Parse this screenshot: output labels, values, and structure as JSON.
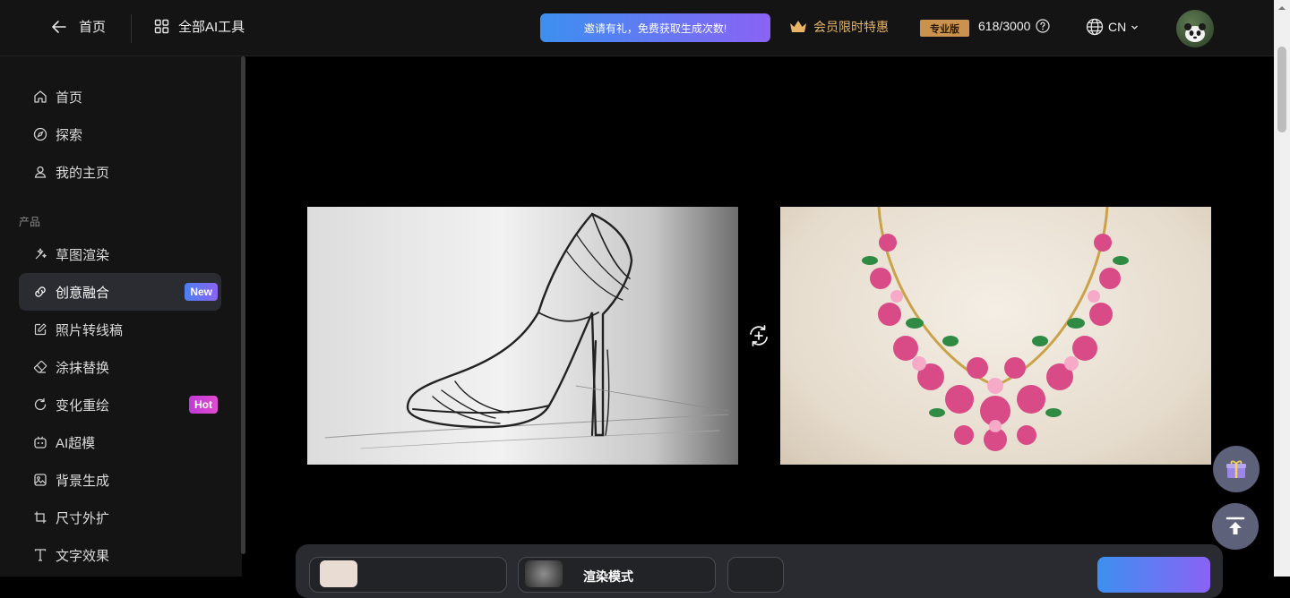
{
  "header": {
    "back_label": "首页",
    "all_tools_label": "全部AI工具",
    "invite_text": "邀请有礼，免费获取生成次数!",
    "vip_text": "会员限时特惠",
    "plan_badge": "专业版",
    "credits": "618/3000",
    "language": "CN"
  },
  "sidebar": {
    "top_items": [
      {
        "label": "首页",
        "icon": "home-icon"
      },
      {
        "label": "探索",
        "icon": "compass-icon"
      },
      {
        "label": "我的主页",
        "icon": "user-icon"
      }
    ],
    "section_label": "产品",
    "product_items": [
      {
        "label": "草图渲染",
        "icon": "magic-wand-icon"
      },
      {
        "label": "创意融合",
        "icon": "link-icon",
        "badge": "New",
        "active": true
      },
      {
        "label": "照片转线稿",
        "icon": "edit-icon"
      },
      {
        "label": "涂抹替换",
        "icon": "eraser-icon"
      },
      {
        "label": "变化重绘",
        "icon": "refresh-icon",
        "badge": "Hot"
      },
      {
        "label": "AI超模",
        "icon": "robot-icon"
      },
      {
        "label": "背景生成",
        "icon": "image-icon"
      },
      {
        "label": "尺寸外扩",
        "icon": "crop-icon"
      },
      {
        "label": "文字效果",
        "icon": "text-icon"
      }
    ]
  },
  "main": {
    "bottom_bar": {
      "render_mode_label": "渲染模式"
    }
  },
  "colors": {
    "accent_gradient_start": "#3d8ff0",
    "accent_gradient_end": "#8a63f5",
    "vip_gold": "#e7b468",
    "badge_new": "#5a78f0",
    "badge_hot": "#d43fd4"
  }
}
